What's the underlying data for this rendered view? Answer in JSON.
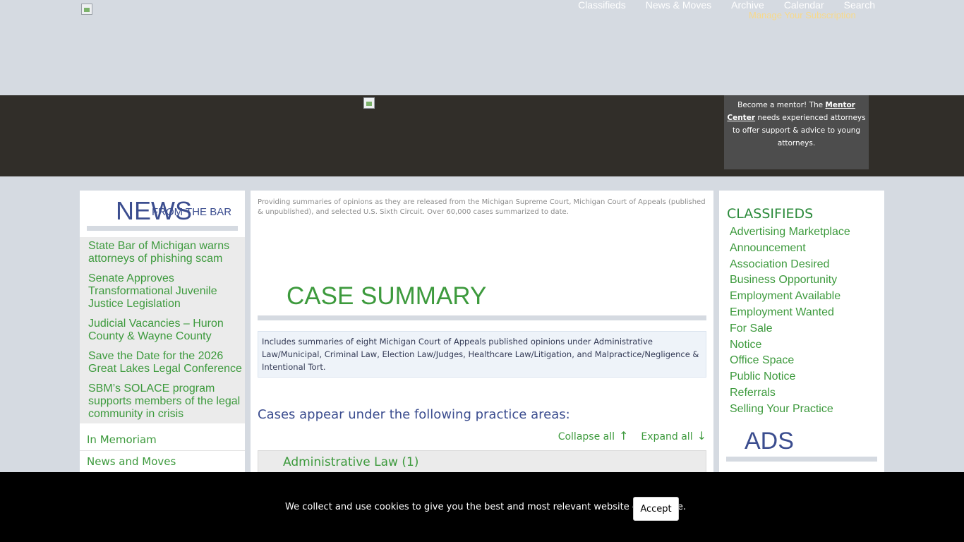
{
  "header": {
    "nav": [
      "Classifieds",
      "News & Moves",
      "Archive",
      "Calendar",
      "Search"
    ],
    "subscription": "Manage Your Subscription"
  },
  "banner": {
    "mentor_prefix": "Become a mentor! The ",
    "mentor_link": "Mentor Center",
    "mentor_suffix": " needs experienced attorneys to offer support & advice to young attorneys."
  },
  "left": {
    "news_big": "NEWS",
    "news_small": "FROM THE BAR",
    "news_items": [
      "State Bar of Michigan warns attorneys of phishing scam",
      "Senate Approves Transformational Juvenile Justice Legislation",
      "Judicial Vacancies – Huron County & Wayne County",
      "Save the Date for the 2026 Great Lakes Legal Conference",
      "SBM’s SOLACE program supports members of the legal community in crisis"
    ],
    "links": [
      "In Memoriam",
      "News and Moves"
    ]
  },
  "main": {
    "intro": "Providing summaries of opinions as they are released from the Michigan Supreme Court, Michigan Court of Appeals (published & unpublished), and selected U.S. Sixth Circuit. Over 60,000 cases summarized to date.",
    "title": "CASE SUMMARY",
    "summary": "Includes summaries of eight Michigan Court of Appeals published opinions under Administrative Law/Municipal, Criminal Law, Election Law/Judges, Healthcare Law/Litigation, and Malpractice/Negligence & Intentional Tort.",
    "areas_heading": "Cases appear under the following practice areas:",
    "collapse_all": "Collapse all",
    "expand_all": "Expand all",
    "first_area": "Administrative Law (1)"
  },
  "right": {
    "classifieds_heading": "CLASSIFIEDS",
    "classifieds": [
      "Advertising Marketplace",
      "Announcement",
      "Association Desired",
      "Business Opportunity",
      "Employment Available",
      "Employment Wanted",
      "For Sale",
      "Notice",
      "Office Space",
      "Public Notice",
      "Referrals",
      "Selling Your Practice"
    ],
    "ads_heading": "ADS"
  },
  "cookie": {
    "text": "We collect and use cookies to give you the best and most relevant website experience.",
    "accept": "Accept"
  }
}
